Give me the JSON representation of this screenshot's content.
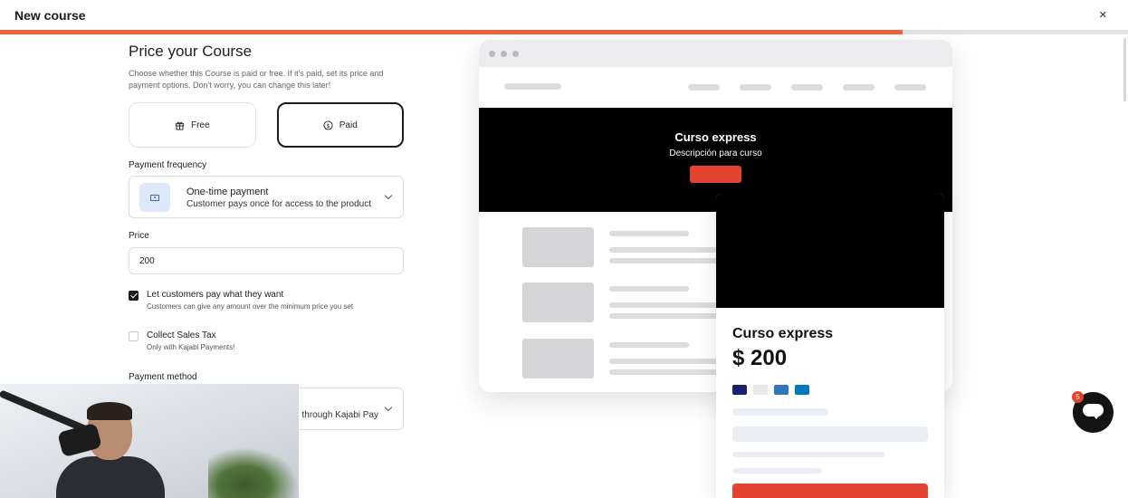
{
  "header": {
    "title": "New course",
    "close_icon": "×"
  },
  "progress": {
    "fraction": 0.8
  },
  "form": {
    "heading": "Price your Course",
    "description": "Choose whether this Course is paid or free. If it's paid, set its price and payment options. Don't worry, you can change this later!",
    "options": [
      {
        "label": "Free",
        "icon": "gift-icon",
        "selected": false
      },
      {
        "label": "Paid",
        "icon": "dollar-circle-icon",
        "selected": true
      }
    ],
    "payment_frequency": {
      "label": "Payment frequency",
      "title": "One-time payment",
      "subtitle": "Customer pays once for access to the product"
    },
    "price": {
      "label": "Price",
      "value": "200"
    },
    "pay_what_you_want": {
      "label": "Let customers pay what they want",
      "help": "Customers can give any amount over the minimum price you set",
      "checked": true
    },
    "sales_tax": {
      "label": "Collect Sales Tax",
      "help": "Only with Kajabi Payments!",
      "checked": false
    },
    "payment_method": {
      "label": "Payment method",
      "value": "through Kajabi Pay"
    }
  },
  "preview": {
    "hero_title": "Curso express",
    "hero_subtitle": "Descripción para curso",
    "card_title": "Curso express",
    "card_price": "$ 200",
    "payment_cards": [
      {
        "name": "visa-card-icon",
        "color": "#1a1f71"
      },
      {
        "name": "mastercard-icon",
        "color": "#e8e8e8"
      },
      {
        "name": "amex-icon",
        "color": "#2e77bb"
      },
      {
        "name": "diners-icon",
        "color": "#0079be"
      }
    ],
    "accent_color": "#e4432f"
  },
  "chat": {
    "unread_count": "5"
  }
}
